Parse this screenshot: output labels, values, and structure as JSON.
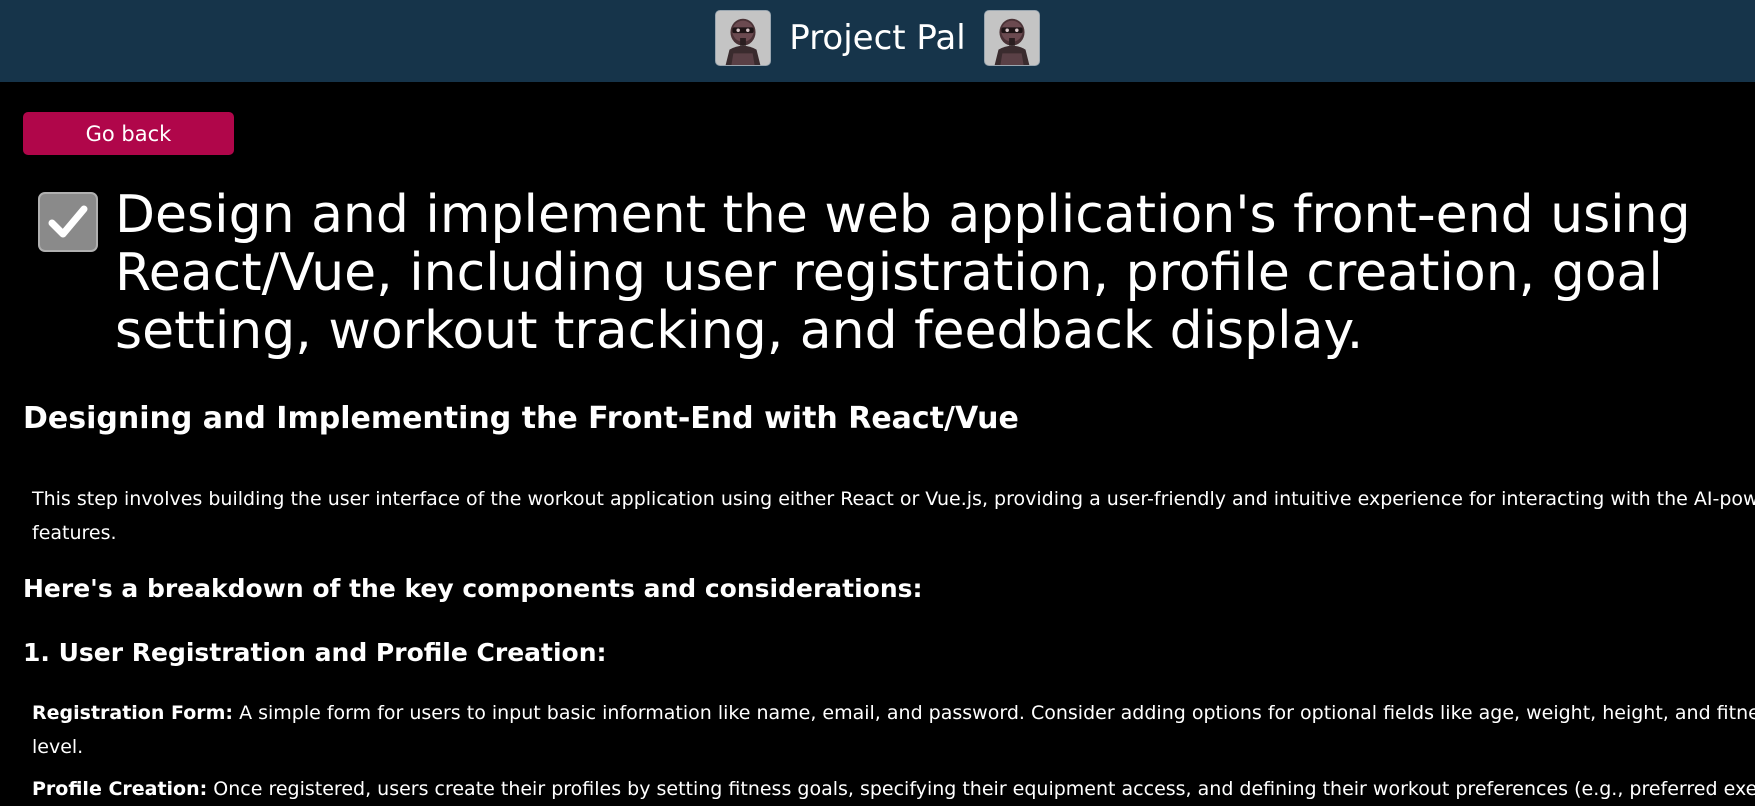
{
  "header": {
    "title": "Project Pal",
    "left_avatar_icon": "robot-avatar-icon",
    "right_avatar_icon": "robot-avatar-icon",
    "background_color": "#16344a"
  },
  "back_button": {
    "label": "Go back",
    "color": "#b0064a"
  },
  "task": {
    "completed": true,
    "checkbox_icon": "checkmark-icon",
    "title_line1": "Design and implement the web application's front-end using",
    "title_line2": "React/Vue, including user registration, profile creation, goal",
    "title_line3": "setting, workout tracking, and feedback display."
  },
  "content": {
    "section_title": "Designing and Implementing the Front-End with React/Vue",
    "intro_line1": "This step involves building the user interface of the workout application using either React or Vue.js, providing a user-friendly and intuitive experience for interacting with the AI-powe",
    "intro_line2": "features.",
    "breakdown_heading": "Here's a breakdown of the key components and considerations:",
    "step1_heading": "1. User Registration and Profile Creation:",
    "items": [
      {
        "label": "Registration Form:",
        "text_line1": " A simple form for users to input basic information like name, email, and password. Consider adding options for optional fields like age, weight, height, and fitness",
        "text_line2": "level."
      },
      {
        "label": "Profile Creation:",
        "text_line1": " Once registered, users create their profiles by setting fitness goals, specifying their equipment access, and defining their workout preferences (e.g., preferred exercis"
      }
    ]
  }
}
